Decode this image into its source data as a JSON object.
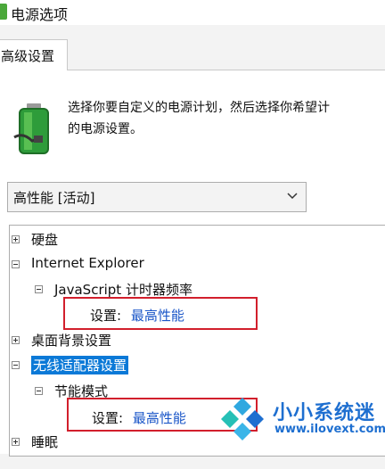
{
  "window": {
    "title": "电源选项"
  },
  "tabs": [
    {
      "label": "高级设置"
    }
  ],
  "description": {
    "line1": "选择你要自定义的电源计划，然后选择你希望计",
    "line2": "的电源设置。"
  },
  "plan_select": {
    "selected": "高性能 [活动]"
  },
  "tree": {
    "items": [
      {
        "label": "硬盘"
      },
      {
        "label": "Internet Explorer"
      },
      {
        "label": "JavaScript 计时器频率"
      },
      {
        "setting_label": "设置:",
        "setting_value": "最高性能"
      },
      {
        "label": "桌面背景设置"
      },
      {
        "label": "无线适配器设置"
      },
      {
        "label": "节能模式"
      },
      {
        "setting_label": "设置:",
        "setting_value": "最高性能"
      },
      {
        "label": "睡眠"
      }
    ]
  },
  "watermark": {
    "name": "小小系统迷",
    "url": "www.ilovext.com"
  },
  "colors": {
    "selection": "#0b79d7",
    "link": "#1a56c8",
    "highlight_box": "#d21f2c",
    "watermark": "#1e6fd0"
  }
}
